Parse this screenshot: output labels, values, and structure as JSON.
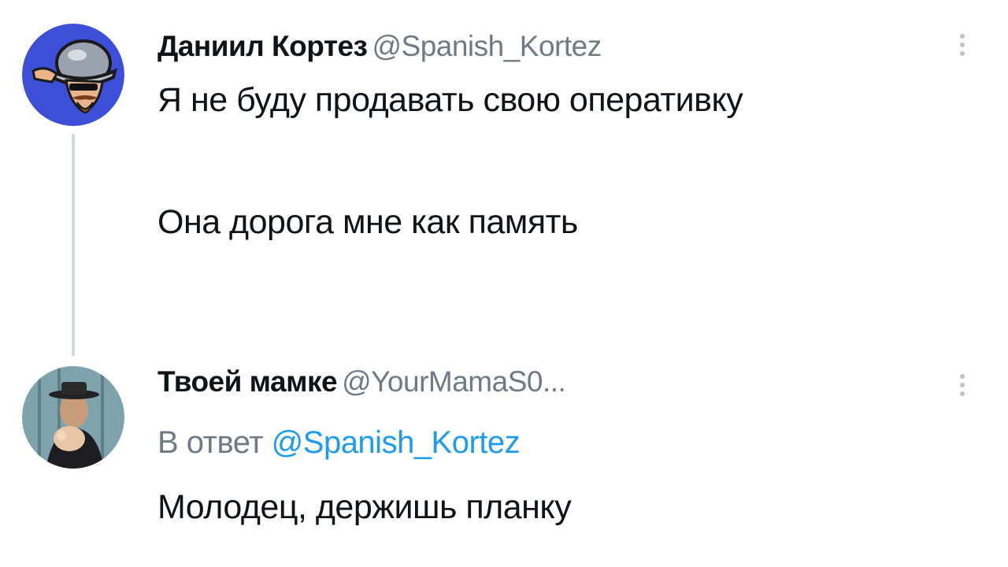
{
  "tweets": [
    {
      "display_name": "Даниил Кортез",
      "handle": "@Spanish_Kortez",
      "text_lines": [
        "Я не буду продавать свою оперативку",
        "Она дорога мне как память"
      ],
      "avatar_icon": "cartoon-conquistador-avatar"
    },
    {
      "display_name": "Твоей мамке",
      "handle": "@YourMamaS0...",
      "reply_prefix": "В ответ",
      "reply_mention": "@Spanish_Kortez",
      "text": "Молодец, держишь планку",
      "avatar_icon": "man-in-hat-photo-avatar"
    }
  ],
  "icons": {
    "more": "more-vertical-icon"
  },
  "colors": {
    "text": "#0f1419",
    "secondary": "#6e7b86",
    "mention": "#1d9bf0",
    "thread_line": "#cfd9de",
    "avatar1_bg": "#3d4ed8"
  }
}
